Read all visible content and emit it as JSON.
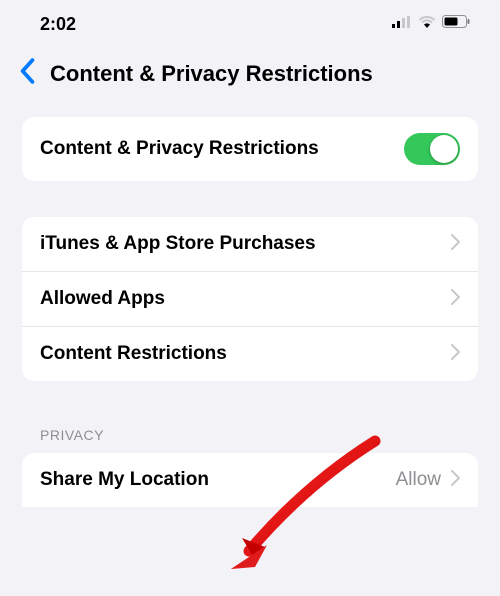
{
  "status": {
    "time": "2:02"
  },
  "nav": {
    "title": "Content & Privacy Restrictions"
  },
  "toggle": {
    "label": "Content & Privacy Restrictions",
    "enabled": true
  },
  "rows": {
    "purchases": "iTunes & App Store Purchases",
    "allowed_apps": "Allowed Apps",
    "content_restrictions": "Content Restrictions"
  },
  "privacy": {
    "header": "PRIVACY",
    "share_location": {
      "label": "Share My Location",
      "value": "Allow"
    }
  }
}
